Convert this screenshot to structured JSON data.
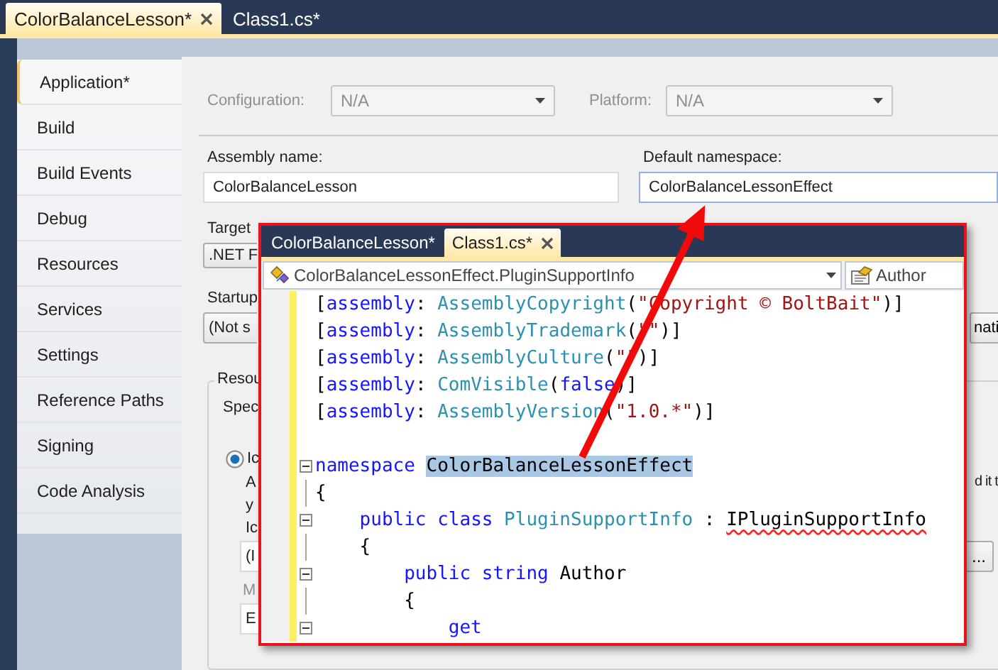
{
  "document_tabs": [
    {
      "label": "ColorBalanceLesson*",
      "selected": true
    },
    {
      "label": "Class1.cs*",
      "selected": false
    }
  ],
  "sidebar": {
    "items": [
      {
        "label": "Application*",
        "selected": true
      },
      {
        "label": "Build",
        "selected": false
      },
      {
        "label": "Build Events",
        "selected": false
      },
      {
        "label": "Debug",
        "selected": false
      },
      {
        "label": "Resources",
        "selected": false
      },
      {
        "label": "Services",
        "selected": false
      },
      {
        "label": "Settings",
        "selected": false
      },
      {
        "label": "Reference Paths",
        "selected": false
      },
      {
        "label": "Signing",
        "selected": false
      },
      {
        "label": "Code Analysis",
        "selected": false
      }
    ]
  },
  "configuration": {
    "label": "Configuration:",
    "value": "N/A",
    "disabled": true
  },
  "platform": {
    "label": "Platform:",
    "value": "N/A",
    "disabled": true
  },
  "assembly_name": {
    "label": "Assembly name:",
    "value": "ColorBalanceLesson",
    "focused": false
  },
  "default_namespace": {
    "label": "Default namespace:",
    "value": "ColorBalanceLessonEffect",
    "focused": true
  },
  "target": {
    "label": "Target",
    "value": ".NET F"
  },
  "startup": {
    "label": "Startup",
    "value": "(Not s"
  },
  "side_button": "nati",
  "resources": {
    "legend": "Resou",
    "text": "Spec",
    "radio": {
      "label": "Ic",
      "selected": true
    },
    "lines": [
      "A",
      "y",
      "Ic"
    ],
    "note": "d it t",
    "icon_field": "(I",
    "browse_button": "...",
    "manifest_label": "M",
    "manifest_field": "E"
  },
  "editor": {
    "tabs": [
      {
        "label": "ColorBalanceLesson*",
        "selected": false
      },
      {
        "label": "Class1.cs*",
        "selected": true
      }
    ],
    "type_combo": "ColorBalanceLessonEffect.PluginSupportInfo",
    "member_combo": "Author",
    "changed": true,
    "lines": [
      {
        "fold": false,
        "tokens": [
          {
            "kind": "plain",
            "text": "["
          },
          {
            "kind": "keyword",
            "text": "assembly"
          },
          {
            "kind": "plain",
            "text": ": "
          },
          {
            "kind": "type",
            "text": "AssemblyCopyright"
          },
          {
            "kind": "plain",
            "text": "("
          },
          {
            "kind": "string",
            "text": "\"Copyright © BoltBait\""
          },
          {
            "kind": "plain",
            "text": ")]"
          }
        ]
      },
      {
        "fold": false,
        "tokens": [
          {
            "kind": "plain",
            "text": "["
          },
          {
            "kind": "keyword",
            "text": "assembly"
          },
          {
            "kind": "plain",
            "text": ": "
          },
          {
            "kind": "type",
            "text": "AssemblyTrademark"
          },
          {
            "kind": "plain",
            "text": "("
          },
          {
            "kind": "string",
            "text": "\"\""
          },
          {
            "kind": "plain",
            "text": ")]"
          }
        ]
      },
      {
        "fold": false,
        "tokens": [
          {
            "kind": "plain",
            "text": "["
          },
          {
            "kind": "keyword",
            "text": "assembly"
          },
          {
            "kind": "plain",
            "text": ": "
          },
          {
            "kind": "type",
            "text": "AssemblyCulture"
          },
          {
            "kind": "plain",
            "text": "("
          },
          {
            "kind": "string",
            "text": "\"\""
          },
          {
            "kind": "plain",
            "text": ")]"
          }
        ]
      },
      {
        "fold": false,
        "tokens": [
          {
            "kind": "plain",
            "text": "["
          },
          {
            "kind": "keyword",
            "text": "assembly"
          },
          {
            "kind": "plain",
            "text": ": "
          },
          {
            "kind": "type",
            "text": "ComVisible"
          },
          {
            "kind": "plain",
            "text": "("
          },
          {
            "kind": "keyword",
            "text": "false"
          },
          {
            "kind": "plain",
            "text": ")]"
          }
        ]
      },
      {
        "fold": false,
        "gap_after": true,
        "tokens": [
          {
            "kind": "plain",
            "text": "["
          },
          {
            "kind": "keyword",
            "text": "assembly"
          },
          {
            "kind": "plain",
            "text": ": "
          },
          {
            "kind": "type",
            "text": "AssemblyVersion"
          },
          {
            "kind": "plain",
            "text": "("
          },
          {
            "kind": "string",
            "text": "\"1.0.*\""
          },
          {
            "kind": "plain",
            "text": ")]"
          }
        ]
      },
      {
        "fold": true,
        "tokens": [
          {
            "kind": "keyword",
            "text": "namespace "
          },
          {
            "kind": "selection",
            "text": "ColorBalanceLessonEffect"
          }
        ],
        "brace": "{",
        "children": [
          {
            "fold": true,
            "tokens": [
              {
                "kind": "keyword",
                "text": "public class "
              },
              {
                "kind": "type",
                "text": "PluginSupportInfo"
              },
              {
                "kind": "plain",
                "text": " : "
              },
              {
                "kind": "error",
                "text": "IPluginSupportInfo"
              }
            ],
            "brace": "{",
            "children": [
              {
                "fold": true,
                "tokens": [
                  {
                    "kind": "keyword",
                    "text": "public string "
                  },
                  {
                    "kind": "plain",
                    "text": "Author"
                  }
                ],
                "brace": "{",
                "children": [
                  {
                    "fold": true,
                    "tokens": [
                      {
                        "kind": "keyword",
                        "text": "get"
                      }
                    ]
                  }
                ]
              }
            ]
          }
        ]
      }
    ]
  }
}
